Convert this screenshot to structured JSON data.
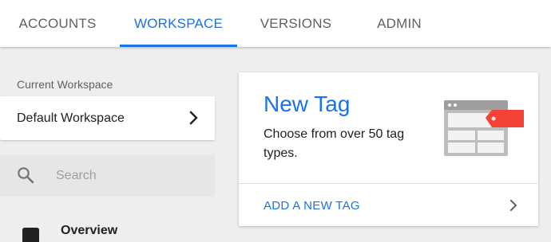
{
  "tabs": [
    {
      "label": "ACCOUNTS"
    },
    {
      "label": "WORKSPACE",
      "active": true
    },
    {
      "label": "VERSIONS"
    },
    {
      "label": "ADMIN"
    }
  ],
  "sidebar": {
    "workspace_caption": "Current Workspace",
    "workspace_name": "Default Workspace",
    "search": {
      "placeholder": "Search",
      "value": ""
    },
    "nav_items": [
      {
        "label": "Overview",
        "icon": "briefcase-icon"
      }
    ]
  },
  "new_tag_card": {
    "title": "New Tag",
    "description": "Choose from over 50 tag types.",
    "action_label": "ADD A NEW TAG",
    "illustration": "tag-template-icon"
  },
  "colors": {
    "accent": "#1a73e8",
    "tag_red": "#f44336",
    "background": "#eeeeee"
  }
}
